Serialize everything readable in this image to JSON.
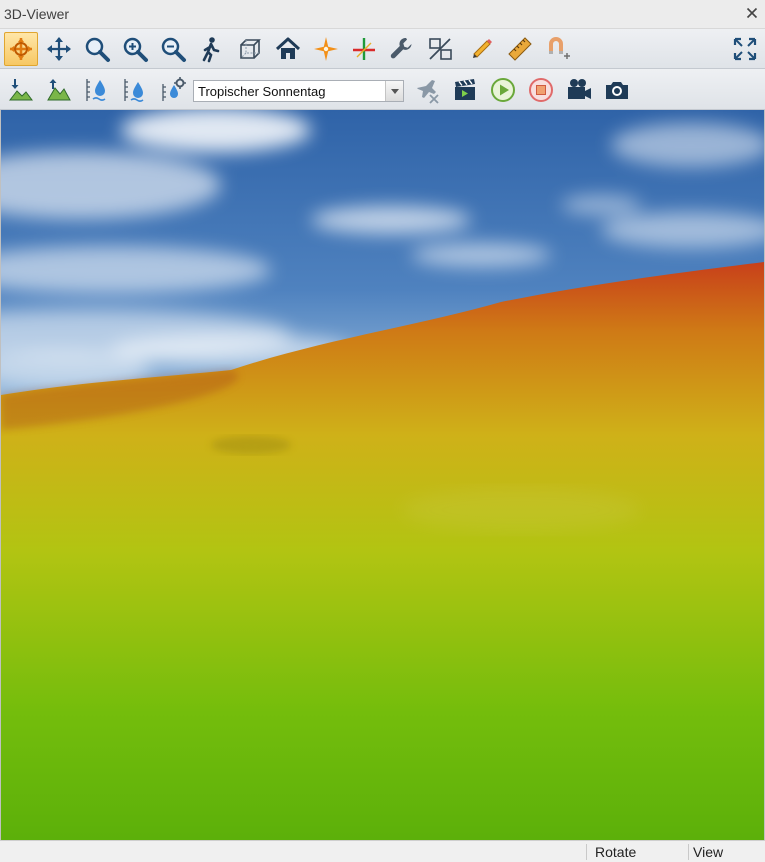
{
  "window": {
    "title": "3D-Viewer",
    "close_icon": "close-icon"
  },
  "toolbar_primary": {
    "buttons": [
      {
        "icon": "navigate-icon",
        "active": true
      },
      {
        "icon": "pan-icon"
      },
      {
        "icon": "zoom-icon"
      },
      {
        "icon": "zoom-in-icon"
      },
      {
        "icon": "zoom-out-icon"
      },
      {
        "icon": "walk-icon"
      },
      {
        "icon": "cube-view-icon"
      },
      {
        "icon": "home-icon"
      },
      {
        "icon": "center-point-icon"
      },
      {
        "icon": "axis-cross-icon"
      },
      {
        "icon": "wrench-icon"
      },
      {
        "icon": "ratio-icon"
      },
      {
        "icon": "pencil-icon"
      },
      {
        "icon": "ruler-icon"
      },
      {
        "icon": "snap-magnet-icon"
      },
      {
        "icon": "fullscreen-icon"
      }
    ]
  },
  "toolbar_secondary": {
    "buttons": [
      {
        "icon": "terrain-down-icon"
      },
      {
        "icon": "terrain-up-icon"
      },
      {
        "icon": "water-level-down-icon"
      },
      {
        "icon": "water-level-up-icon"
      },
      {
        "icon": "water-settings-icon"
      },
      {
        "icon": "flight-disabled-icon"
      },
      {
        "icon": "clapperboard-icon"
      },
      {
        "icon": "play-icon"
      },
      {
        "icon": "stop-icon"
      },
      {
        "icon": "video-camera-icon"
      },
      {
        "icon": "photo-camera-icon"
      }
    ],
    "sky_preset": {
      "selected": "Tropischer Sonnentag"
    }
  },
  "statusbar": {
    "mode": "Rotate",
    "view": "View"
  },
  "colors": {
    "sky_top": "#2f63a8",
    "sky_horizon": "#8fb4d8",
    "terrain_ridge": "#c8421a",
    "terrain_mid": "#cdbf18",
    "terrain_near": "#63b80a",
    "active_button": "#f7c864"
  }
}
